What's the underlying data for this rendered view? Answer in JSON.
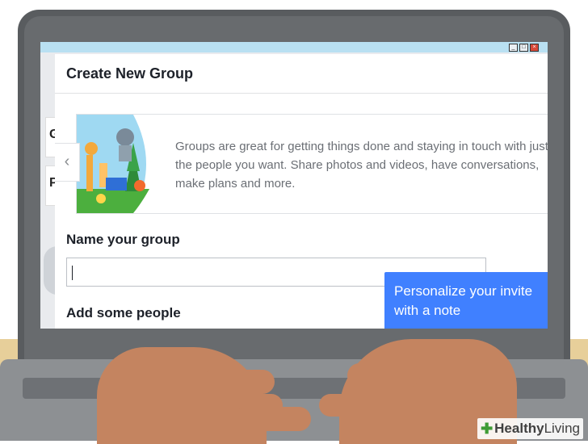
{
  "window_controls": {
    "minimize": "_",
    "maximize": "□",
    "close": "×"
  },
  "background": {
    "left_glyph_1": "G",
    "left_glyph_2": "P"
  },
  "dialog": {
    "title": "Create New Group",
    "prev_arrow": "‹",
    "promo_text": "Groups are great for getting things done and staying in touch with just the people you want. Share photos and videos, have conversations, make plans and more.",
    "name_label": "Name your group",
    "name_value": "",
    "people_label": "Add some people"
  },
  "tooltip": {
    "text": "Personalize your invite with a note"
  },
  "watermark": {
    "icon": "✚",
    "text_bold": "Healthy",
    "text_regular": "Living"
  },
  "colors": {
    "accent": "#4080ff",
    "screen_frame": "#3b5998",
    "watermark_green": "#3f9c35"
  },
  "icons": [
    "chevron-left-icon",
    "minimize-icon",
    "maximize-icon",
    "close-icon",
    "group-illustration"
  ]
}
